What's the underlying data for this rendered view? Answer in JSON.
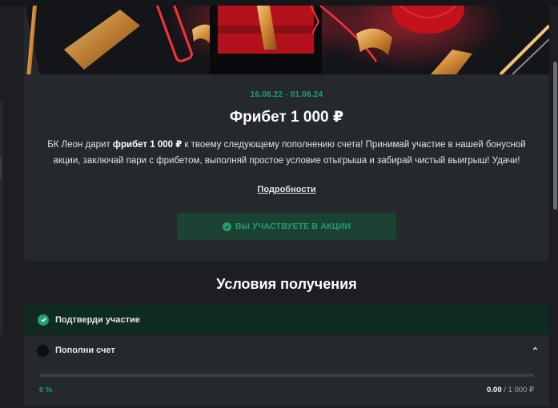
{
  "promo": {
    "dates": "16.06.22 - 01.06.24",
    "title": "Фрибет 1 000 ₽",
    "desc_before": "БК Леон дарит ",
    "desc_bold": "фрибет 1 000 ₽",
    "desc_after": " к твоему следующему пополнению счета! Принимай участие в нашей бонусной акции, заключай пари с фрибетом, выполняй простое условие отыгрыша и забирай чистый выигрыш! Удачи!",
    "details_label": "Подробности",
    "participate_label": "ВЫ УЧАСТВУЕТЕ В АКЦИИ"
  },
  "conditions": {
    "title": "Условия получения",
    "steps": [
      {
        "label": "Подтверди участие",
        "status": "done"
      },
      {
        "label": "Пополни счет",
        "status": "pending"
      }
    ],
    "deposit": {
      "progress": 0,
      "percent_label": "0 %",
      "current": "0.00",
      "separator": "/",
      "target": "1 000 ₽"
    }
  },
  "colors": {
    "accent_green": "#22a06b",
    "card_bg": "#25282c",
    "page_bg": "#1c1e22",
    "done_bg": "#0f2a1f",
    "banner_red": "#c8141e",
    "banner_gold": "#e0a24c"
  },
  "icons": {
    "participate": "check-circle-icon",
    "step_done": "check-circle-icon",
    "step_pending": "empty-circle-icon",
    "collapse": "chevron-up-icon"
  }
}
